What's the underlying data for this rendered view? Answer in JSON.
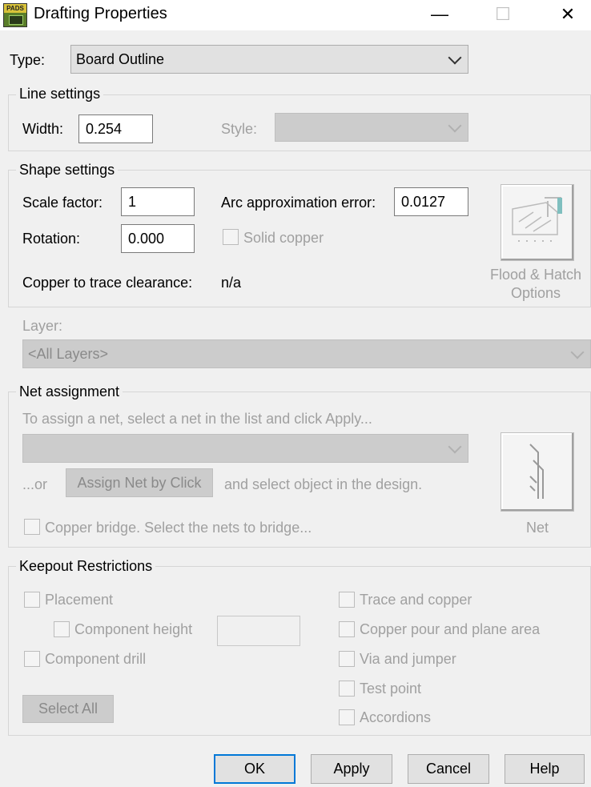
{
  "window": {
    "title": "Drafting Properties",
    "app_icon_text": "PADS",
    "minimize_glyph": "—",
    "maximize_glyph": "☐",
    "close_glyph": "✕"
  },
  "type": {
    "label": "Type:",
    "value": "Board Outline"
  },
  "line_settings": {
    "legend": "Line settings",
    "width_label": "Width:",
    "width_value": "0.254",
    "style_label": "Style:",
    "style_value": ""
  },
  "shape_settings": {
    "legend": "Shape settings",
    "scale_label": "Scale factor:",
    "scale_value": "1",
    "arc_label": "Arc approximation error:",
    "arc_value": "0.0127",
    "rotation_label": "Rotation:",
    "rotation_value": "0.000",
    "solid_copper_label": "Solid copper",
    "clearance_label": "Copper to trace clearance:",
    "clearance_value": "n/a",
    "flood_line1": "Flood & Hatch",
    "flood_line2": "Options"
  },
  "layer": {
    "label": "Layer:",
    "value": "<All Layers>"
  },
  "net_assignment": {
    "legend": "Net assignment",
    "hint": "To assign a net, select a net in the list and click Apply...",
    "net_value": "",
    "or_text": "...or",
    "assign_button": "Assign Net by Click",
    "after_text": "and select object in the design.",
    "copper_bridge_label": "Copper bridge. Select the nets to bridge...",
    "net_button_caption": "Net"
  },
  "keepout": {
    "legend": "Keepout Restrictions",
    "placement": "Placement",
    "component_height": "Component height",
    "component_height_value": "",
    "component_drill": "Component drill",
    "trace_copper": "Trace and copper",
    "copper_pour": "Copper pour and plane area",
    "via_jumper": "Via and jumper",
    "test_point": "Test point",
    "accordions": "Accordions",
    "select_all": "Select All"
  },
  "buttons": {
    "ok": "OK",
    "apply": "Apply",
    "cancel": "Cancel",
    "help": "Help"
  },
  "colors": {
    "accent": "#0078d7",
    "disabled_text": "#a0a0a0",
    "dialog_bg": "#f0f0f0"
  }
}
